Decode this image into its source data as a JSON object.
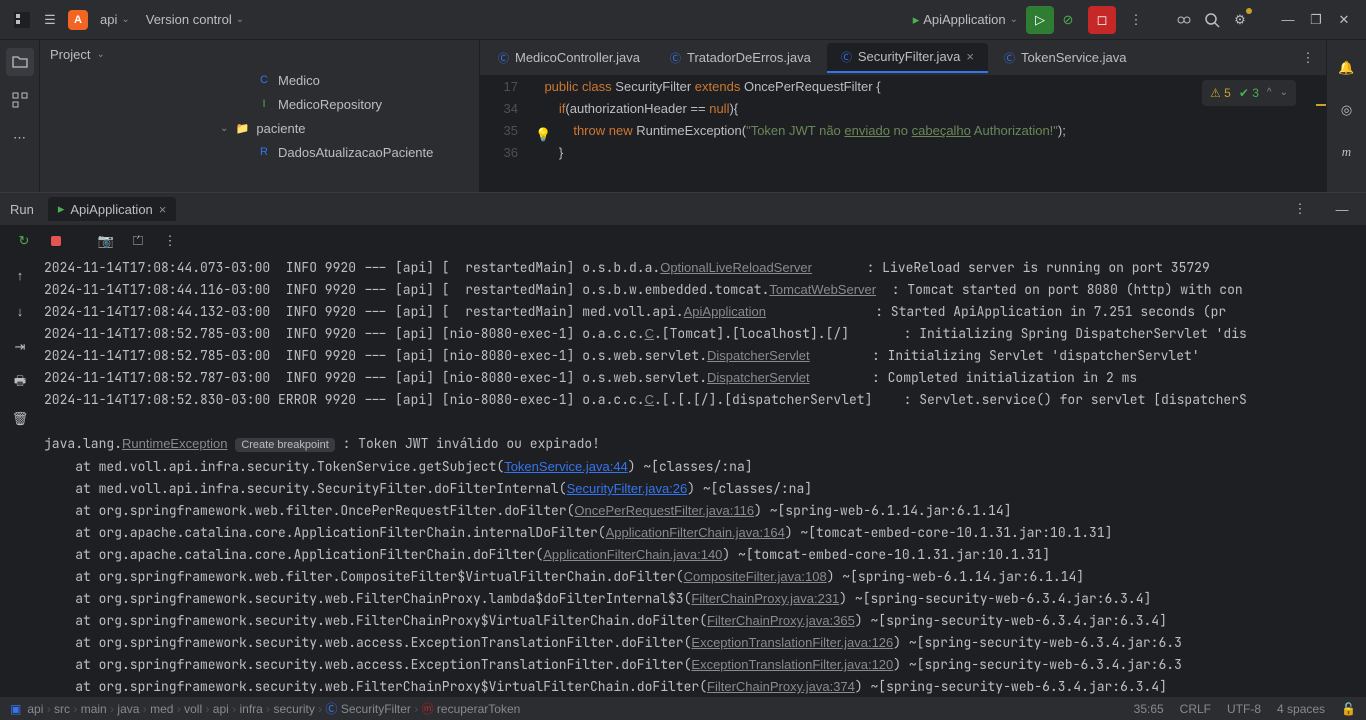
{
  "titlebar": {
    "project": "api",
    "vcs": "Version control",
    "run_config": "ApiApplication"
  },
  "project_panel": {
    "title": "Project",
    "tree": [
      {
        "icon": "C",
        "icon_class": "c-blue",
        "label": "Medico",
        "indent": 0
      },
      {
        "icon": "I",
        "icon_class": "i-green",
        "label": "MedicoRepository",
        "indent": 0
      },
      {
        "icon": "📁",
        "icon_class": "folder",
        "label": "paciente",
        "indent": -1,
        "expand": "v"
      },
      {
        "icon": "R",
        "icon_class": "c-blue",
        "label": "DadosAtualizacaoPaciente",
        "indent": 0
      }
    ]
  },
  "tabs": [
    {
      "label": "MedicoController.java",
      "active": false
    },
    {
      "label": "TratadorDeErros.java",
      "active": false
    },
    {
      "label": "SecurityFilter.java",
      "active": true
    },
    {
      "label": "TokenService.java",
      "active": false
    }
  ],
  "code": {
    "lines": [
      {
        "n": 17,
        "html": "<span class='kw-pub'>public</span> <span class='kw-cls'>class</span> <span class='cls-name'>SecurityFilter</span> <span class='kw-ext'>extends</span> <span class='cls-name'>OncePerRequestFilter</span> <span class='brace'>{</span>"
      },
      {
        "n": 34,
        "html": "        <span class='kw-pub'>if</span>(authorizationHeader == <span class='kw-pub'>null</span>){"
      },
      {
        "n": 35,
        "html": "            <span class='kw-pub'>throw</span> <span class='kw-pub'>new</span> RuntimeException(<span class='strlit'>\"Token JWT não <u>enviado</u> no <u>cabeçalho</u> Authorization!\"</span>);"
      },
      {
        "n": 36,
        "html": "        }"
      }
    ],
    "warnings": "5",
    "oks": "3"
  },
  "run": {
    "title": "Run",
    "tab": "ApiApplication",
    "log": [
      "2024-11-14T17:08:44.073-03:00  INFO 9920 --- [api] [  restartedMain] o.s.b.d.a.<span class='loglink'>OptionalLiveReloadServer</span>       : LiveReload server is running on port 35729",
      "2024-11-14T17:08:44.116-03:00  INFO 9920 --- [api] [  restartedMain] o.s.b.w.embedded.tomcat.<span class='loglink'>TomcatWebServer</span>  : Tomcat started on port 8080 (http) with con",
      "2024-11-14T17:08:44.132-03:00  INFO 9920 --- [api] [  restartedMain] med.voll.api.<span class='loglink'>ApiApplication</span>              : Started ApiApplication in 7.251 seconds (pr",
      "2024-11-14T17:08:52.785-03:00  INFO 9920 --- [api] [nio-8080-exec-1] o.a.c.c.<span class='loglink'>C</span>.[Tomcat].[localhost].[/]       : Initializing Spring DispatcherServlet 'dis",
      "2024-11-14T17:08:52.785-03:00  INFO 9920 --- [api] [nio-8080-exec-1] o.s.web.servlet.<span class='loglink'>DispatcherServlet</span>        : Initializing Servlet 'dispatcherServlet'",
      "2024-11-14T17:08:52.787-03:00  INFO 9920 --- [api] [nio-8080-exec-1] o.s.web.servlet.<span class='loglink'>DispatcherServlet</span>        : Completed initialization in 2 ms",
      "2024-11-14T17:08:52.830-03:00 ERROR 9920 --- [api] [nio-8080-exec-1] o.a.c.c.<span class='loglink'>C</span>.[.[.[/].[dispatcherServlet]    : Servlet.service() for servlet [dispatcherS",
      "",
      "java.lang.<span class='loglink'>RuntimeException</span> <span class='bp-hint'>Create breakpoint</span> : Token JWT inválido ou expirado!",
      "    at med.voll.api.infra.security.TokenService.getSubject(<span class='linku'>TokenService.java:44</span>) ~[classes/:na]",
      "    at med.voll.api.infra.security.SecurityFilter.doFilterInternal(<span class='linku'>SecurityFilter.java:26</span>) ~[classes/:na]",
      "    at org.springframework.web.filter.OncePerRequestFilter.doFilter(<span class='linkg'>OncePerRequestFilter.java:116</span>) ~[spring-web-6.1.14.jar:6.1.14]",
      "    at org.apache.catalina.core.ApplicationFilterChain.internalDoFilter(<span class='linkg'>ApplicationFilterChain.java:164</span>) ~[tomcat-embed-core-10.1.31.jar:10.1.31]",
      "    at org.apache.catalina.core.ApplicationFilterChain.doFilter(<span class='linkg'>ApplicationFilterChain.java:140</span>) ~[tomcat-embed-core-10.1.31.jar:10.1.31]",
      "    at org.springframework.web.filter.CompositeFilter$VirtualFilterChain.doFilter(<span class='linkg'>CompositeFilter.java:108</span>) ~[spring-web-6.1.14.jar:6.1.14]",
      "    at org.springframework.security.web.FilterChainProxy.lambda$doFilterInternal$3(<span class='linkg'>FilterChainProxy.java:231</span>) ~[spring-security-web-6.3.4.jar:6.3.4]",
      "    at org.springframework.security.web.FilterChainProxy$VirtualFilterChain.doFilter(<span class='linkg'>FilterChainProxy.java:365</span>) ~[spring-security-web-6.3.4.jar:6.3.4]",
      "    at org.springframework.security.web.access.ExceptionTranslationFilter.doFilter(<span class='linkg'>ExceptionTranslationFilter.java:126</span>) ~[spring-security-web-6.3.4.jar:6.3",
      "    at org.springframework.security.web.access.ExceptionTranslationFilter.doFilter(<span class='linkg'>ExceptionTranslationFilter.java:120</span>) ~[spring-security-web-6.3.4.jar:6.3",
      "    at org.springframework.security.web.FilterChainProxy$VirtualFilterChain.doFilter(<span class='linkg'>FilterChainProxy.java:374</span>) ~[spring-security-web-6.3.4.jar:6.3.4]"
    ]
  },
  "breadcrumb": [
    "api",
    "src",
    "main",
    "java",
    "med",
    "voll",
    "api",
    "infra",
    "security",
    "SecurityFilter",
    "recuperarToken"
  ],
  "status": {
    "pos": "35:65",
    "eol": "CRLF",
    "enc": "UTF-8",
    "indent": "4 spaces"
  }
}
